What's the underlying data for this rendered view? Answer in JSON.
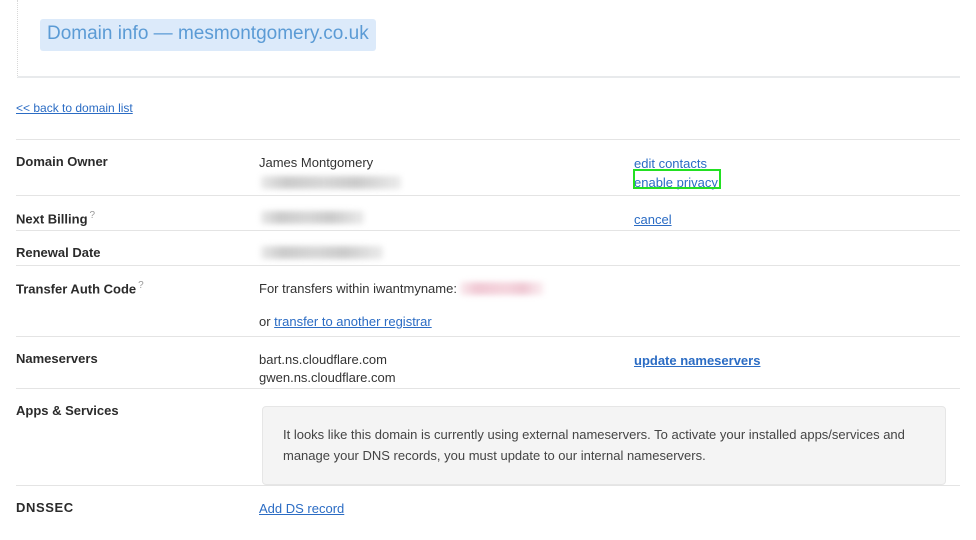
{
  "header": {
    "title": "Domain info — mesmontgomery.co.uk",
    "title_highlight_color": "#dceafa",
    "title_text_color": "#5b9bd5"
  },
  "nav": {
    "back_link": "<< back to domain list"
  },
  "rows": {
    "owner": {
      "label": "Domain Owner",
      "value": "James Montgomery",
      "redacted_value": "",
      "actions": [
        {
          "label": "edit contacts",
          "name": "edit-contacts-link",
          "bold": false
        },
        {
          "label": "enable privacy",
          "name": "enable-privacy-link",
          "bold": false
        }
      ]
    },
    "next_billing": {
      "label": "Next Billing",
      "help": "?",
      "redacted_value": "",
      "actions": [
        {
          "label": "cancel",
          "name": "cancel-link",
          "bold": false
        }
      ]
    },
    "renewal_date": {
      "label": "Renewal Date",
      "redacted_value": ""
    },
    "transfer_auth": {
      "label": "Transfer Auth Code",
      "help": "?",
      "value_prefix": "For transfers within iwantmyname:",
      "redacted_value": "",
      "second_line_prefix": "or ",
      "second_line_link": "transfer to another registrar"
    },
    "nameservers": {
      "label": "Nameservers",
      "values": [
        "bart.ns.cloudflare.com",
        "gwen.ns.cloudflare.com"
      ],
      "actions": [
        {
          "label": "update nameservers",
          "name": "update-nameservers-link",
          "bold": true
        }
      ]
    },
    "apps_services": {
      "label": "Apps & Services",
      "notice": "It looks like this domain is currently using external nameservers. To activate your installed apps/services and manage your DNS records, you must update to our internal nameservers."
    },
    "dnssec": {
      "label": "DNSSEC",
      "action": {
        "label": "Add DS record",
        "name": "add-ds-record-link"
      }
    }
  },
  "annotation": {
    "highlight_color": "#22e022",
    "target": "enable privacy"
  }
}
